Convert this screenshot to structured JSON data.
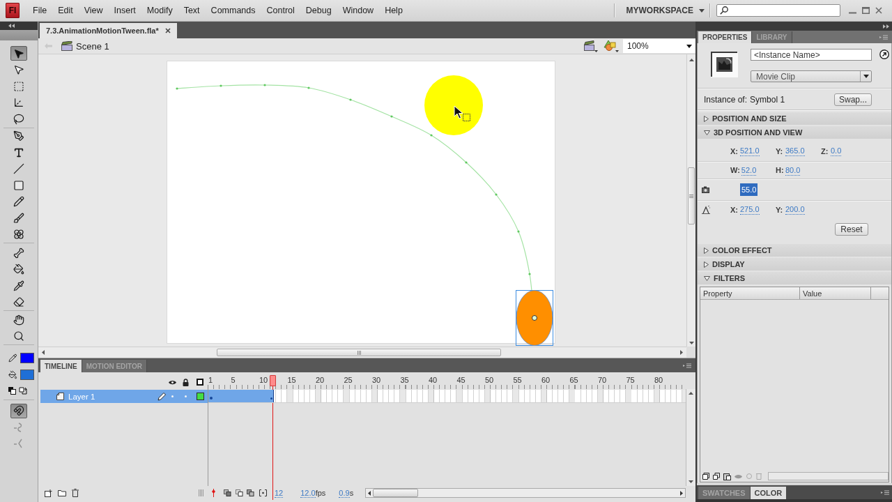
{
  "app": {
    "logo": "Fl"
  },
  "menu": [
    "File",
    "Edit",
    "View",
    "Insert",
    "Modify",
    "Text",
    "Commands",
    "Control",
    "Debug",
    "Window",
    "Help"
  ],
  "workspace": {
    "label": "MYWORKSPACE"
  },
  "document_tabs": [
    {
      "label": "7.3.AnimationMotionTween.fla*",
      "selected": true
    }
  ],
  "edit_bar": {
    "scene": "Scene 1",
    "zoom": "100%"
  },
  "tool_groups": [
    {
      "tools": [
        {
          "kind": "selection",
          "selected": true
        },
        {
          "kind": "subselection",
          "selected": false
        },
        {
          "kind": "transform",
          "selected": false
        },
        {
          "kind": "rotate3d",
          "selected": false
        },
        {
          "kind": "lasso",
          "selected": false
        }
      ]
    },
    {
      "tools": [
        {
          "kind": "pen",
          "selected": false
        },
        {
          "kind": "text",
          "selected": false
        },
        {
          "kind": "line",
          "selected": false
        },
        {
          "kind": "rectangle",
          "selected": false
        },
        {
          "kind": "pencil",
          "selected": false
        },
        {
          "kind": "brush",
          "selected": false
        },
        {
          "kind": "deco",
          "selected": false
        }
      ]
    },
    {
      "tools": [
        {
          "kind": "bone",
          "selected": false
        },
        {
          "kind": "bucket",
          "selected": false
        },
        {
          "kind": "eyedropper",
          "selected": false
        },
        {
          "kind": "eraser",
          "selected": false
        }
      ]
    },
    {
      "tools": [
        {
          "kind": "hand",
          "selected": false
        },
        {
          "kind": "zoom",
          "selected": false
        }
      ]
    }
  ],
  "colors": [
    {
      "kind": "stroke",
      "color": "#0000ff"
    },
    {
      "kind": "fill",
      "color": "#1f6fd6"
    }
  ],
  "options": [
    {
      "kind": "snap",
      "on": true,
      "disabled": false
    },
    {
      "kind": "smooth",
      "on": false,
      "disabled": true
    },
    {
      "kind": "straighten",
      "on": false,
      "disabled": true
    }
  ],
  "timeline": {
    "tabs": [
      {
        "label": "TIMELINE",
        "selected": true
      },
      {
        "label": "MOTION EDITOR",
        "selected": false
      }
    ],
    "frame_labels": [
      "1",
      "5",
      "10",
      "15",
      "20",
      "25",
      "30",
      "35",
      "40",
      "45",
      "50",
      "55",
      "60",
      "65",
      "70",
      "75",
      "80"
    ],
    "playhead": {
      "level": 0.136
    },
    "layers": [
      {
        "name": "Layer 1",
        "selected": true,
        "color": "#44dd44"
      }
    ],
    "current_frame": "12",
    "frame_rate": "12.0",
    "frame_rate_unit": "fps",
    "elapsed_time": "0.9",
    "elapsed_unit": "s"
  },
  "properties": {
    "tabs": [
      {
        "label": "PROPERTIES",
        "selected": true
      },
      {
        "label": "LIBRARY",
        "selected": false
      }
    ],
    "instance_name": {
      "placeholder": "<Instance Name>"
    },
    "symbol_type": "Movie Clip",
    "instance_of": {
      "label": "Instance of:",
      "value": "Symbol 1"
    },
    "swap_button": "Swap...",
    "sections": [
      {
        "kind": "plain",
        "title": "POSITION AND SIZE",
        "expanded": false
      },
      {
        "kind": "view3d",
        "title": "3D POSITION AND VIEW",
        "expanded": true,
        "rows": [
          {
            "kind": "position",
            "fields": [
              {
                "label": "X:",
                "value": "521.0",
                "selected": false
              },
              {
                "label": "Y:",
                "value": "365.0",
                "selected": false
              },
              {
                "label": "Z:",
                "value": "0.0",
                "selected": false
              }
            ]
          },
          {
            "kind": "size",
            "fields": [
              {
                "label": "W:",
                "value": "52.0",
                "selected": false
              },
              {
                "label": "H:",
                "value": "80.0",
                "selected": false
              }
            ]
          },
          {
            "kind": "perspective",
            "fields": [
              {
                "value": "55.0",
                "selected": true
              }
            ]
          },
          {
            "kind": "vanishing",
            "fields": [
              {
                "label": "X:",
                "value": "275.0",
                "selected": false
              },
              {
                "label": "Y:",
                "value": "200.0",
                "selected": false
              }
            ]
          },
          {
            "kind": "reset",
            "button": "Reset"
          }
        ]
      },
      {
        "kind": "plain",
        "title": "COLOR EFFECT",
        "expanded": false
      },
      {
        "kind": "plain",
        "title": "DISPLAY",
        "expanded": false
      },
      {
        "kind": "filters",
        "title": "FILTERS",
        "expanded": true,
        "columns": [
          "Property",
          "Value"
        ]
      }
    ]
  },
  "color_panel": {
    "tabs": [
      {
        "label": "SWATCHES",
        "selected": false
      },
      {
        "label": "COLOR",
        "selected": true
      }
    ]
  }
}
